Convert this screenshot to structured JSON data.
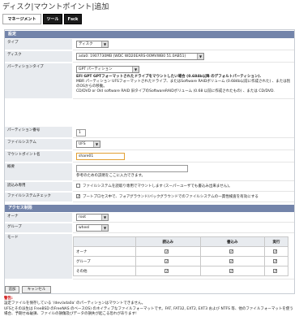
{
  "page_title": "ディスク|マウントポイント|追加",
  "tabs": [
    {
      "label": "マネージメント"
    },
    {
      "label": "ツール"
    },
    {
      "label": "Fsck"
    }
  ],
  "settings": {
    "header": "設定",
    "type": {
      "label": "タイプ",
      "value": "ディスク"
    },
    "disk": {
      "label": "ディスク",
      "value": "ada0: 1907730MB (WDC WD20EARS-00MVWB0 51.0AB51)"
    },
    "partition_type": {
      "label": "パーティションタイプ",
      "value": "GPT パーティション",
      "desc1": "EFI GPT GPTフォーマットされたドライブをマウントしたい場合 (0.684b以降 のデフォルトパーティション).",
      "desc2": "MBR パーティション UFSフォーマットされたドライブ、またはSoftware RAIDボリューム (0.684b以前に作成された) 、または別のOSからの移動。",
      "desc3": "CD/DVD or Old software RAID 旧タイプのSoftwareRAIDボリューム (0.68 以前に作成されたもの) 、または CD/DVD."
    },
    "partition_number": {
      "label": "パーティション番号",
      "value": "1"
    },
    "filesystem": {
      "label": "ファイルシステム",
      "value": "UFS"
    },
    "mount_name": {
      "label": "マウントポイント名",
      "value": "share01"
    },
    "description": {
      "label": "概要",
      "help": "参考のための説明をここに入力できます。"
    },
    "readonly": {
      "label": "読込み専用",
      "text": "ファイルシステムを読取り専用でマウントします (スーパーユーザでも書込み出来ません)。"
    },
    "fscheck": {
      "label": "ファイルシステムチェック",
      "text": "ブートプロセス中で、フォアグラウンド/バックグラウンドでのファイルシステムの一貫性検査を有効にする"
    }
  },
  "access": {
    "header": "アクセス制限",
    "owner": {
      "label": "オーナ",
      "value": "root"
    },
    "group": {
      "label": "グループ",
      "value": "wheel"
    },
    "mode": {
      "label": "モード",
      "columns": [
        "",
        "読込み",
        "書込み",
        "実行"
      ],
      "rows": [
        {
          "name": "オーナ"
        },
        {
          "name": "グループ"
        },
        {
          "name": "その他"
        }
      ]
    }
  },
  "buttons": {
    "add": "追加",
    "cancel": "キャンセル"
  },
  "warning": {
    "title": "警告:",
    "line1": "設定ファイルを保存している '/dev/ada0a' のパーティションはマウントできません。",
    "line2": "UFSとその派生は FreeBSD のFreeNAS のベースOS) のネイティブなファイルフォーマットです。FAT, FAT32, EXT2, EXT3 および NTFS 等、他のファイルフォーマットを使う場合、予期せぬ破損、ファイルの損傷及びデータの損失が起こる恐れがあります!"
  }
}
